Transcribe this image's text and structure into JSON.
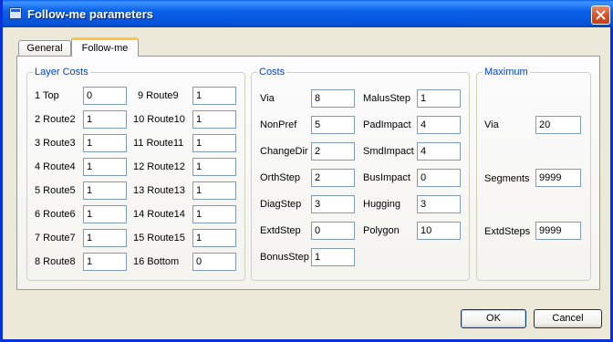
{
  "window": {
    "title": "Follow-me parameters"
  },
  "tabs": [
    {
      "label": "General",
      "active": false
    },
    {
      "label": "Follow-me",
      "active": true
    }
  ],
  "layer_costs": {
    "title": "Layer Costs",
    "items": [
      {
        "label": "1  Top",
        "value": "0"
      },
      {
        "label": "2  Route2",
        "value": "1"
      },
      {
        "label": "3  Route3",
        "value": "1"
      },
      {
        "label": "4  Route4",
        "value": "1"
      },
      {
        "label": "5  Route5",
        "value": "1"
      },
      {
        "label": "6  Route6",
        "value": "1"
      },
      {
        "label": "7  Route7",
        "value": "1"
      },
      {
        "label": "8  Route8",
        "value": "1"
      },
      {
        "label": "9  Route9",
        "value": "1"
      },
      {
        "label": "10 Route10",
        "value": "1"
      },
      {
        "label": "11 Route11",
        "value": "1"
      },
      {
        "label": "12 Route12",
        "value": "1"
      },
      {
        "label": "13 Route13",
        "value": "1"
      },
      {
        "label": "14 Route14",
        "value": "1"
      },
      {
        "label": "15 Route15",
        "value": "1"
      },
      {
        "label": "16 Bottom",
        "value": "0"
      }
    ]
  },
  "costs": {
    "title": "Costs",
    "items": [
      {
        "label": "Via",
        "value": "8"
      },
      {
        "label": "NonPref",
        "value": "5"
      },
      {
        "label": "ChangeDir",
        "value": "2"
      },
      {
        "label": "OrthStep",
        "value": "2"
      },
      {
        "label": "DiagStep",
        "value": "3"
      },
      {
        "label": "ExtdStep",
        "value": "0"
      },
      {
        "label": "BonusStep",
        "value": "1"
      },
      {
        "label": "MalusStep",
        "value": "1"
      },
      {
        "label": "PadImpact",
        "value": "4"
      },
      {
        "label": "SmdImpact",
        "value": "4"
      },
      {
        "label": "BusImpact",
        "value": "0"
      },
      {
        "label": "Hugging",
        "value": "3"
      },
      {
        "label": "Polygon",
        "value": "10"
      }
    ]
  },
  "maximum": {
    "title": "Maximum",
    "items": [
      {
        "label": "Via",
        "value": "20"
      },
      {
        "label": "Segments",
        "value": "9999"
      },
      {
        "label": "ExtdSteps",
        "value": "9999"
      }
    ]
  },
  "buttons": {
    "ok": "OK",
    "cancel": "Cancel"
  },
  "colors": {
    "title_bar": "#0553d7",
    "group_title": "#0046d5",
    "active_tab_accent": "#ffc83c",
    "close_button": "#d64f28"
  }
}
